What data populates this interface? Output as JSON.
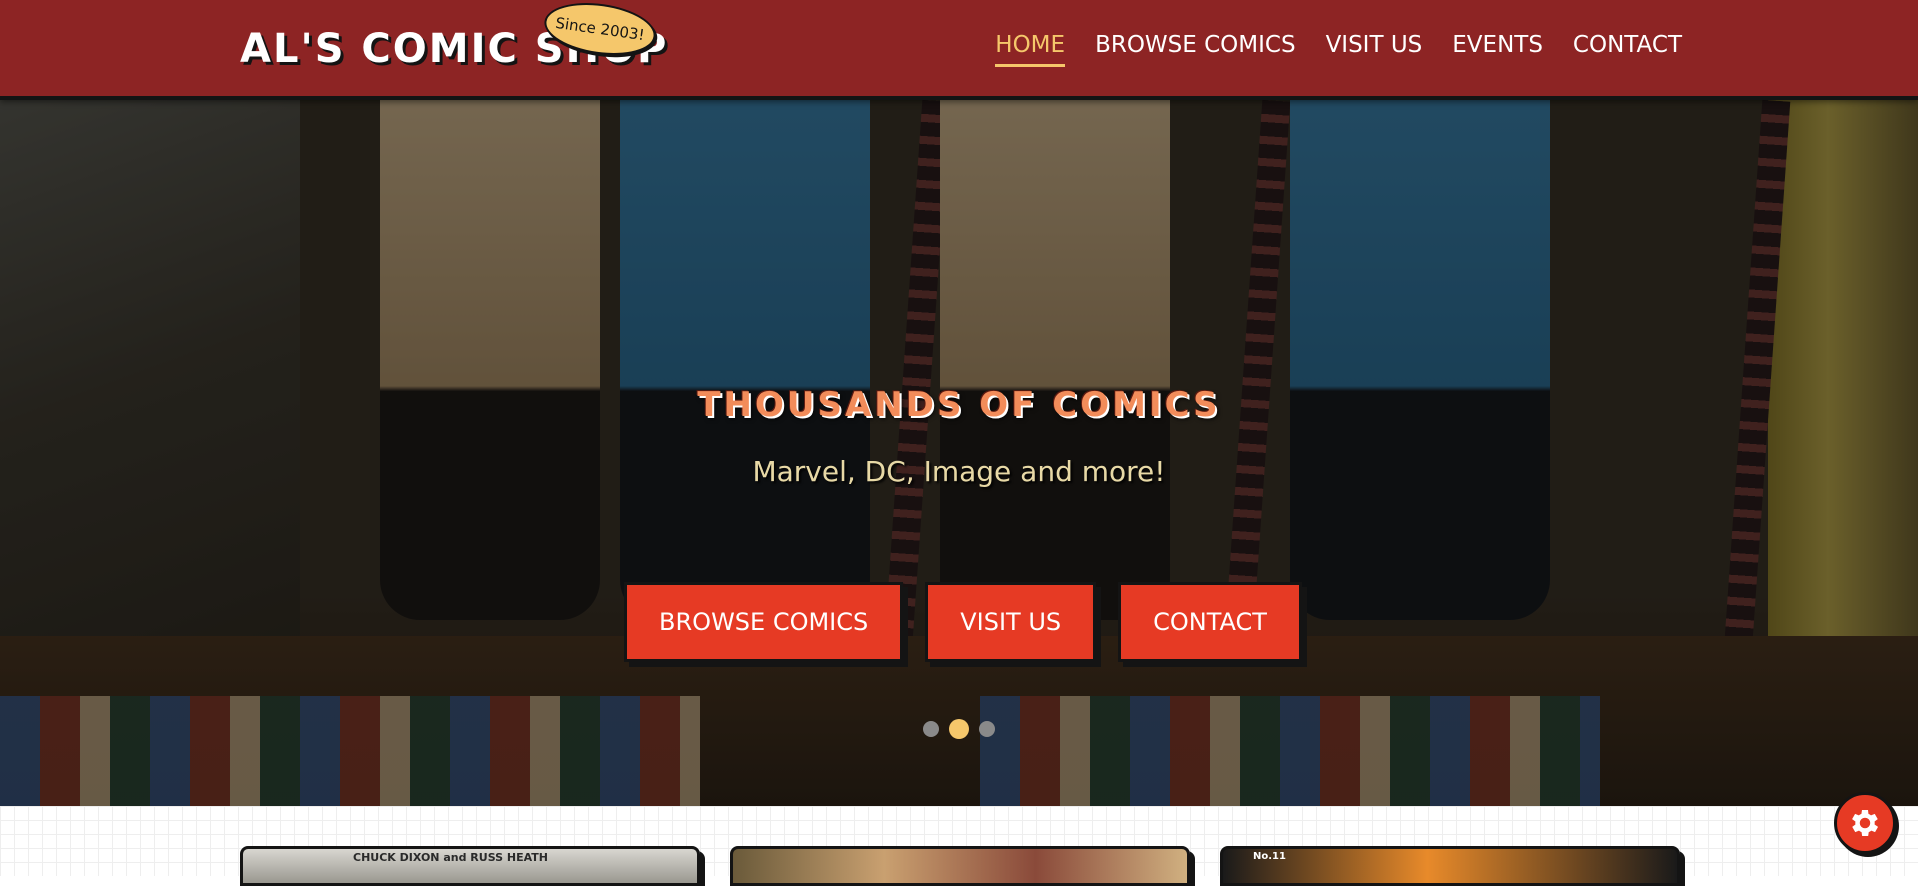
{
  "header": {
    "brand": "AL'S COMIC SHOP",
    "badge": "Since 2003!",
    "nav": [
      {
        "label": "HOME",
        "active": true
      },
      {
        "label": "BROWSE COMICS",
        "active": false
      },
      {
        "label": "VISIT US",
        "active": false
      },
      {
        "label": "EVENTS",
        "active": false
      },
      {
        "label": "CONTACT",
        "active": false
      }
    ]
  },
  "hero": {
    "title": "THOUSANDS OF COMICS",
    "subtitle": "Marvel, DC, Image and more!",
    "buttons": [
      {
        "label": "BROWSE COMICS"
      },
      {
        "label": "VISIT US"
      },
      {
        "label": "CONTACT"
      }
    ],
    "slides": {
      "count": 3,
      "active_index": 1
    }
  },
  "cards": [
    {
      "caption": "CHUCK DIXON and RUSS HEATH"
    },
    {
      "caption": ""
    },
    {
      "caption": "No.11"
    }
  ],
  "settings_button": {
    "icon": "gear-icon"
  },
  "colors": {
    "header_bg": "#8d2424",
    "accent_red": "#e63a24",
    "accent_gold": "#f5c76b",
    "outline": "#141414"
  }
}
